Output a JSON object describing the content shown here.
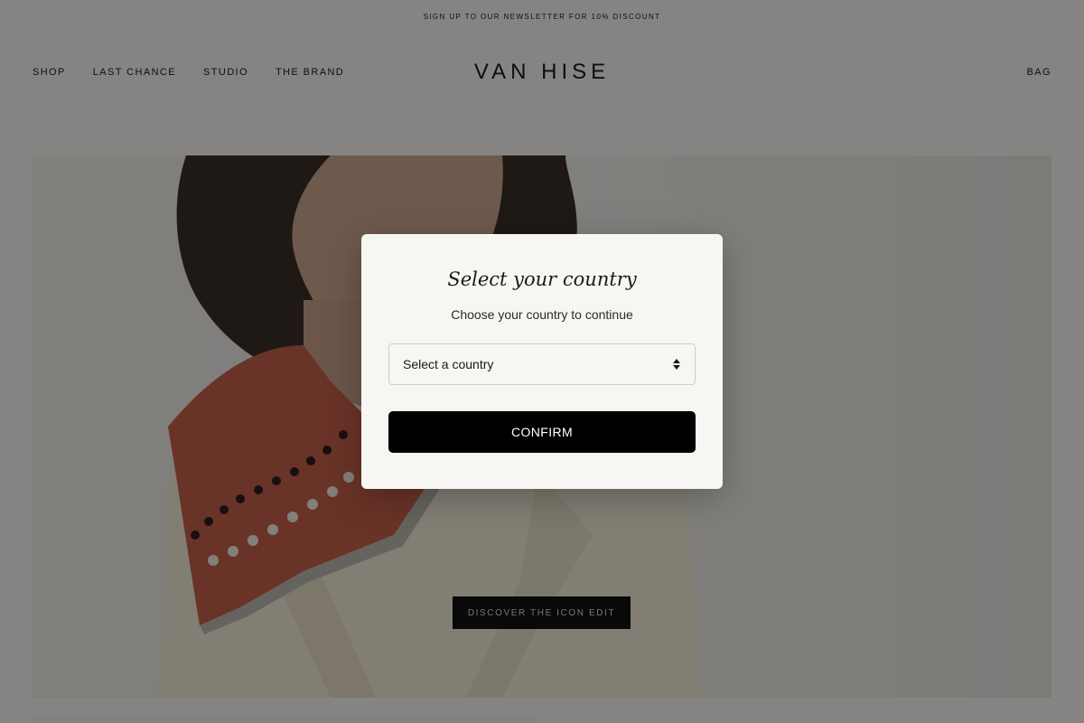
{
  "promo": {
    "text": "SIGN UP TO OUR NEWSLETTER FOR 10% DISCOUNT"
  },
  "nav": {
    "items": [
      {
        "label": "SHOP"
      },
      {
        "label": "LAST CHANCE"
      },
      {
        "label": "STUDIO"
      },
      {
        "label": "THE BRAND"
      }
    ]
  },
  "brand": {
    "logo": "VAN HISE"
  },
  "header": {
    "bag_label": "BAG"
  },
  "hero": {
    "cta_label": "DISCOVER THE ICON EDIT"
  },
  "modal": {
    "title": "Select your country",
    "subtitle": "Choose your country to continue",
    "select_value": "Select a country",
    "confirm_label": "CONFIRM"
  },
  "colors": {
    "overlay": "#000000",
    "modal_bg": "#f7f6f3",
    "button_bg": "#000000",
    "scarf": "#c25d48"
  }
}
